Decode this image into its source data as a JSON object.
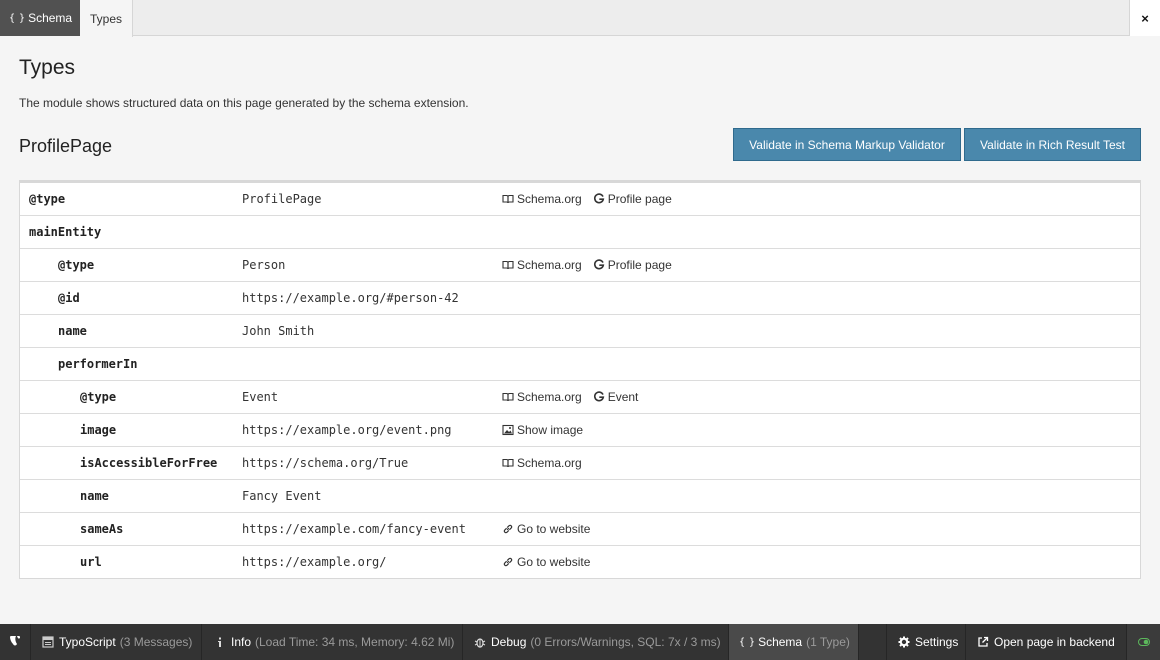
{
  "tabs": {
    "schema_label": "Schema",
    "types_label": "Types",
    "close_label": "×"
  },
  "content": {
    "title": "Types",
    "description": "The module shows structured data on this page generated by the schema extension.",
    "subtitle": "ProfilePage",
    "validate_markup_label": "Validate in Schema Markup Validator",
    "validate_rich_label": "Validate in Rich Result Test"
  },
  "table": {
    "rows": [
      {
        "key": "@type",
        "value": "ProfilePage",
        "level": 0,
        "links": [
          {
            "icon": "book-icon",
            "label": "Schema.org"
          },
          {
            "icon": "google-icon",
            "label": "Profile page"
          }
        ]
      },
      {
        "key": "mainEntity",
        "value": "",
        "level": 0,
        "links": []
      },
      {
        "key": "@type",
        "value": "Person",
        "level": 1,
        "links": [
          {
            "icon": "book-icon",
            "label": "Schema.org"
          },
          {
            "icon": "google-icon",
            "label": "Profile page"
          }
        ]
      },
      {
        "key": "@id",
        "value": "https://example.org/#person-42",
        "level": 1,
        "links": []
      },
      {
        "key": "name",
        "value": "John Smith",
        "level": 1,
        "links": []
      },
      {
        "key": "performerIn",
        "value": "",
        "level": 1,
        "links": []
      },
      {
        "key": "@type",
        "value": "Event",
        "level": 2,
        "links": [
          {
            "icon": "book-icon",
            "label": "Schema.org"
          },
          {
            "icon": "google-icon",
            "label": "Event"
          }
        ]
      },
      {
        "key": "image",
        "value": "https://example.org/event.png",
        "level": 2,
        "links": [
          {
            "icon": "image-icon",
            "label": "Show image"
          }
        ]
      },
      {
        "key": "isAccessibleForFree",
        "value": "https://schema.org/True",
        "level": 2,
        "links": [
          {
            "icon": "book-icon",
            "label": "Schema.org"
          }
        ]
      },
      {
        "key": "name",
        "value": "Fancy Event",
        "level": 2,
        "links": []
      },
      {
        "key": "sameAs",
        "value": "https://example.com/fancy-event",
        "level": 2,
        "links": [
          {
            "icon": "link-icon",
            "label": "Go to website"
          }
        ]
      },
      {
        "key": "url",
        "value": "https://example.org/",
        "level": 2,
        "links": [
          {
            "icon": "link-icon",
            "label": "Go to website"
          }
        ]
      }
    ]
  },
  "toolbar": {
    "typoscript_label": "TypoScript",
    "typoscript_detail": "(3 Messages)",
    "info_label": "Info",
    "info_detail": "(Load Time: 34 ms, Memory: 4.62 Mi)",
    "debug_label": "Debug",
    "debug_detail": "(0 Errors/Warnings, SQL: 7x / 3 ms)",
    "schema_label": "Schema",
    "schema_detail": "(1 Type)",
    "settings_label": "Settings",
    "open_backend_label": "Open page in backend"
  },
  "colors": {
    "button_bg": "#4a88ac",
    "toolbar_bg": "#333333",
    "toggle_on": "#5cb85c"
  }
}
